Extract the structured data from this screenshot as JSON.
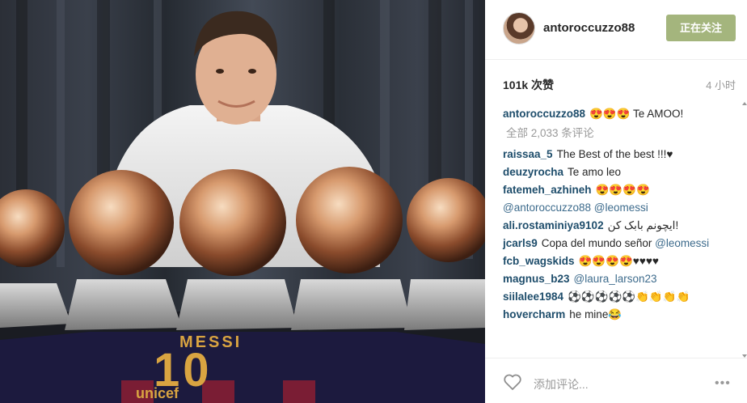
{
  "post": {
    "image_alt": "",
    "jersey_name": "MESSI",
    "jersey_number": "10",
    "jersey_sponsor": "unicef"
  },
  "header": {
    "username": "antoroccuzzo88",
    "follow_label": "正在关注"
  },
  "stats": {
    "likes": "101k 次赞",
    "time": "4 小时"
  },
  "caption": {
    "user": "antoroccuzzo88",
    "text": "😍😍😍 Te AMOO!"
  },
  "load_more": "全部 2,033 条评论",
  "comments": [
    {
      "user": "raissaa_5",
      "text": "The Best of the best !!!♥",
      "mention": ""
    },
    {
      "user": "deuzyrocha",
      "text": "Te amo leo",
      "mention": ""
    },
    {
      "user": "fatemeh_azhineh",
      "text": "😍😍😍😍",
      "mention": "@antoroccuzzo88 @leomessi"
    },
    {
      "user": "ali.rostaminiya9102",
      "text": "ایچونم بابک کن!",
      "mention": ""
    },
    {
      "user": "jcarls9",
      "text": "Copa del mundo señor",
      "mention": "@leomessi"
    },
    {
      "user": "fcb_wagskids",
      "text": "😍😍😍😍♥♥♥♥",
      "mention": ""
    },
    {
      "user": "magnus_b23",
      "text": "",
      "mention": "@laura_larson23"
    },
    {
      "user": "siilalee1984",
      "text": "⚽⚽⚽⚽⚽👏👏👏👏",
      "mention": ""
    },
    {
      "user": "hovercharm",
      "text": "he mine😂",
      "mention": ""
    }
  ],
  "footer": {
    "input_placeholder": "添加评论...",
    "more_label": "•••"
  },
  "colors": {
    "follow_button": "#a4b57d",
    "username_link": "#1e4d6b",
    "mention": "#3d6b8c",
    "muted": "#999999"
  },
  "icons": {
    "like": "heart-icon",
    "more": "more-icon",
    "avatar": "avatar"
  }
}
